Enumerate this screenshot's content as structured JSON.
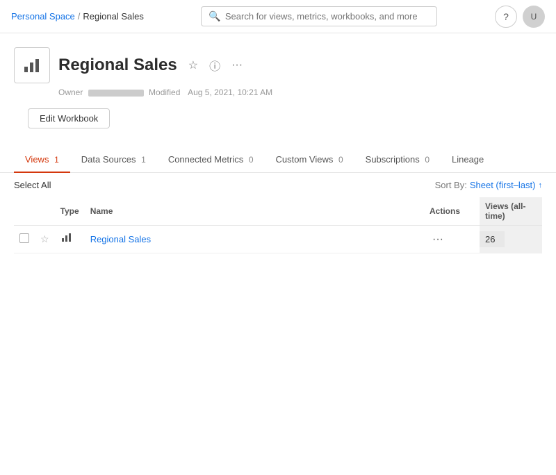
{
  "nav": {
    "breadcrumb_personal": "Personal Space",
    "breadcrumb_sep": "/",
    "breadcrumb_current": "Regional Sales",
    "search_placeholder": "Search for views, metrics, workbooks, and more",
    "help_label": "?",
    "avatar_label": "U"
  },
  "workbook": {
    "title": "Regional Sales",
    "icon_symbol": "▮",
    "owner_label": "Owner",
    "modified_label": "Modified",
    "modified_date": "Aug 5, 2021, 10:21 AM"
  },
  "buttons": {
    "edit_workbook": "Edit Workbook"
  },
  "tabs": [
    {
      "id": "views",
      "label": "Views",
      "count": "1",
      "active": true
    },
    {
      "id": "data-sources",
      "label": "Data Sources",
      "count": "1",
      "active": false
    },
    {
      "id": "connected-metrics",
      "label": "Connected Metrics",
      "count": "0",
      "active": false
    },
    {
      "id": "custom-views",
      "label": "Custom Views",
      "count": "0",
      "active": false
    },
    {
      "id": "subscriptions",
      "label": "Subscriptions",
      "count": "0",
      "active": false
    },
    {
      "id": "lineage",
      "label": "Lineage",
      "count": "",
      "active": false
    }
  ],
  "table_controls": {
    "select_all": "Select All",
    "sort_by_label": "Sort By:",
    "sort_by_value": "Sheet (first–last)",
    "sort_arrow": "↑"
  },
  "table": {
    "columns": [
      {
        "id": "check",
        "label": ""
      },
      {
        "id": "star",
        "label": ""
      },
      {
        "id": "type",
        "label": "Type"
      },
      {
        "id": "name",
        "label": "Name"
      },
      {
        "id": "actions",
        "label": "Actions"
      },
      {
        "id": "views",
        "label": "Views (all-time)"
      }
    ],
    "rows": [
      {
        "name": "Regional Sales",
        "type_icon": "▮",
        "views_count": "26"
      }
    ]
  }
}
